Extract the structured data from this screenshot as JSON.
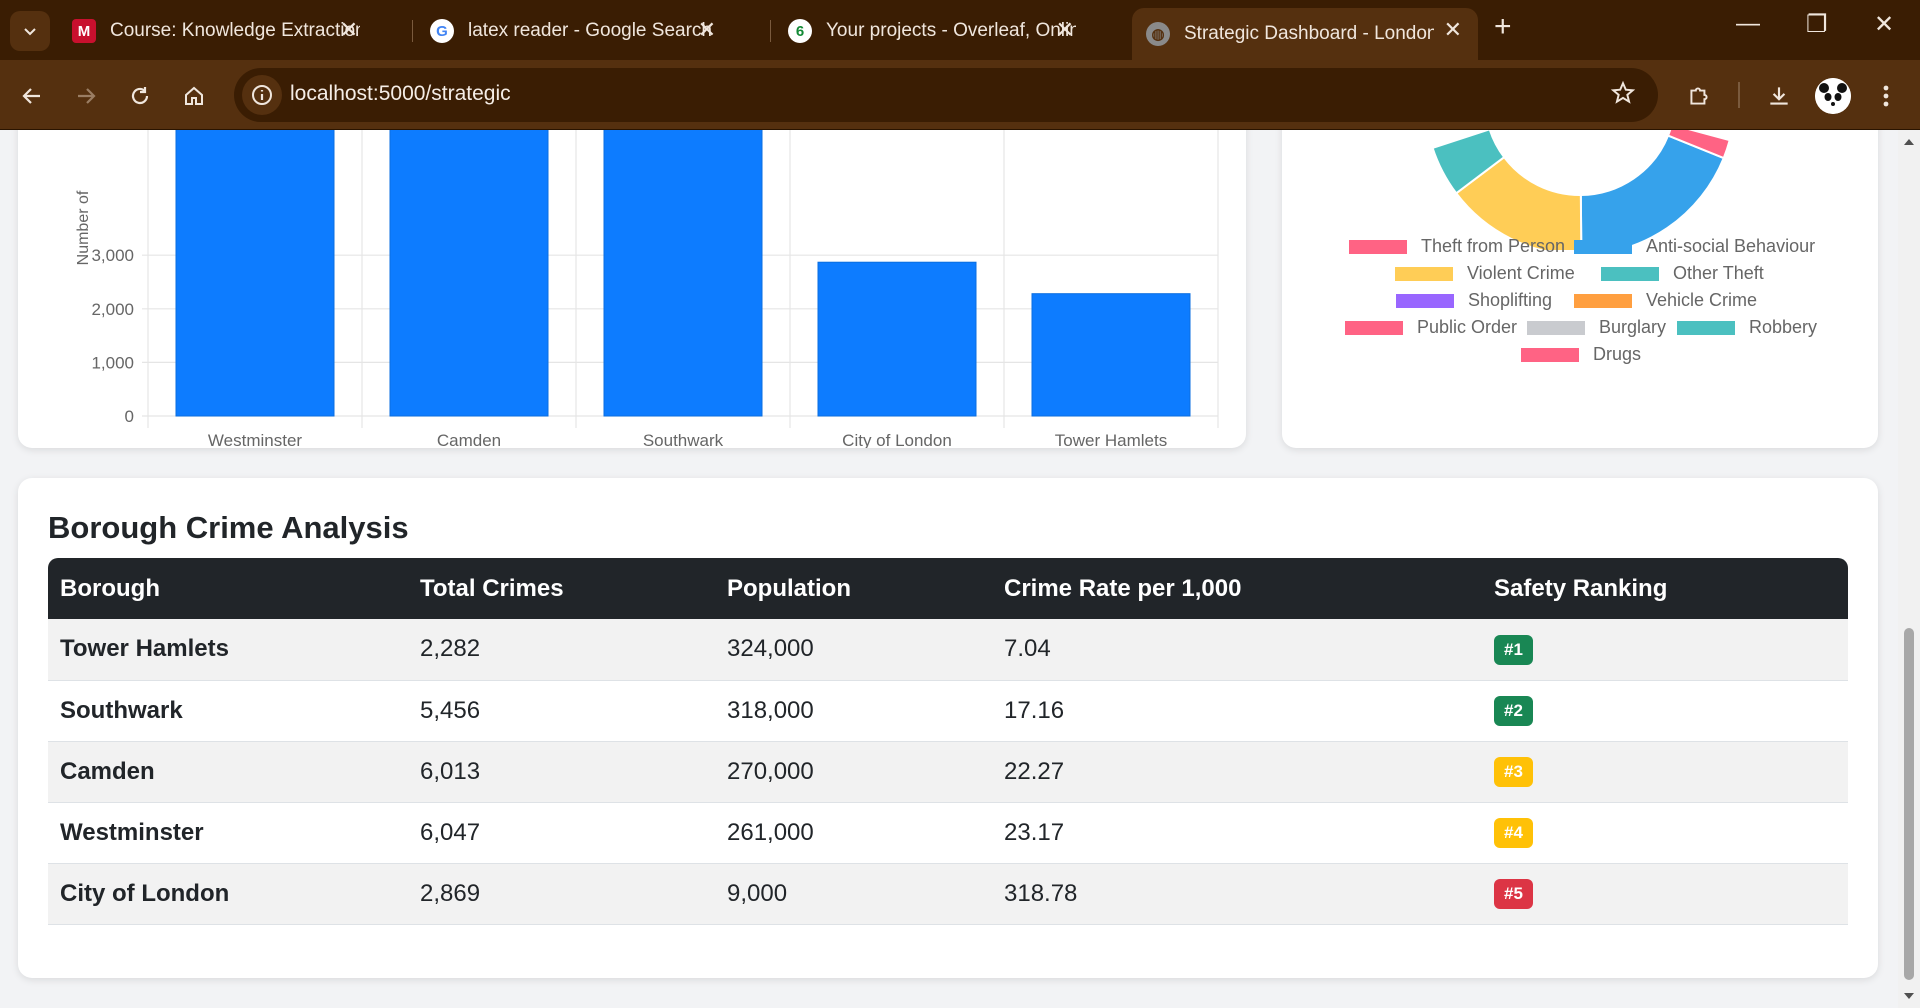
{
  "browser": {
    "tabs": [
      {
        "title": "Course: Knowledge Extraction, M",
        "icon": "moodle-icon"
      },
      {
        "title": "latex reader - Google Search",
        "icon": "google-icon"
      },
      {
        "title": "Your projects - Overleaf, Online",
        "icon": "overleaf-icon"
      },
      {
        "title": "Strategic Dashboard - London C",
        "icon": "globe-icon",
        "active": true
      }
    ],
    "url": "localhost:5000/strategic"
  },
  "colors": {
    "chrome_dark": "#3a1d03",
    "chrome_mid": "#55300f",
    "bar": "#0d7cff",
    "badge_green": "#198754",
    "badge_yellow": "#ffc107",
    "badge_red": "#dc3545"
  },
  "chart_data": [
    {
      "type": "bar",
      "ylabel": "Number of",
      "categories": [
        "Westminster",
        "Camden",
        "Southwark",
        "City of London",
        "Tower Hamlets"
      ],
      "values": [
        6047,
        6013,
        5456,
        2869,
        2282
      ],
      "yticks": [
        "0",
        "1,000",
        "2,000",
        "3,000"
      ],
      "ylim": [
        0,
        3800
      ],
      "grid": true,
      "color": "#0d7cff"
    },
    {
      "type": "pie",
      "legend_position": "bottom",
      "legend": [
        {
          "label": "Theft from Person",
          "color": "#ff6384"
        },
        {
          "label": "Anti-social Behaviour",
          "color": "#36a2eb"
        },
        {
          "label": "Violent Crime",
          "color": "#ffcd56"
        },
        {
          "label": "Other Theft",
          "color": "#4bc0c0"
        },
        {
          "label": "Shoplifting",
          "color": "#9966ff"
        },
        {
          "label": "Vehicle Crime",
          "color": "#ff9f40"
        },
        {
          "label": "Public Order",
          "color": "#ff6384"
        },
        {
          "label": "Burglary",
          "color": "#c9cbcf"
        },
        {
          "label": "Robbery",
          "color": "#4bc0c0"
        },
        {
          "label": "Drugs",
          "color": "#ff6384"
        }
      ]
    }
  ],
  "table": {
    "title": "Borough Crime Analysis",
    "headers": [
      "Borough",
      "Total Crimes",
      "Population",
      "Crime Rate per 1,000",
      "Safety Ranking"
    ],
    "rows": [
      {
        "borough": "Tower Hamlets",
        "total": "2,282",
        "population": "324,000",
        "rate": "7.04",
        "rank": "#1",
        "level": "green"
      },
      {
        "borough": "Southwark",
        "total": "5,456",
        "population": "318,000",
        "rate": "17.16",
        "rank": "#2",
        "level": "green"
      },
      {
        "borough": "Camden",
        "total": "6,013",
        "population": "270,000",
        "rate": "22.27",
        "rank": "#3",
        "level": "yellow"
      },
      {
        "borough": "Westminster",
        "total": "6,047",
        "population": "261,000",
        "rate": "23.17",
        "rank": "#4",
        "level": "yellow"
      },
      {
        "borough": "City of London",
        "total": "2,869",
        "population": "9,000",
        "rate": "318.78",
        "rank": "#5",
        "level": "red"
      }
    ]
  }
}
